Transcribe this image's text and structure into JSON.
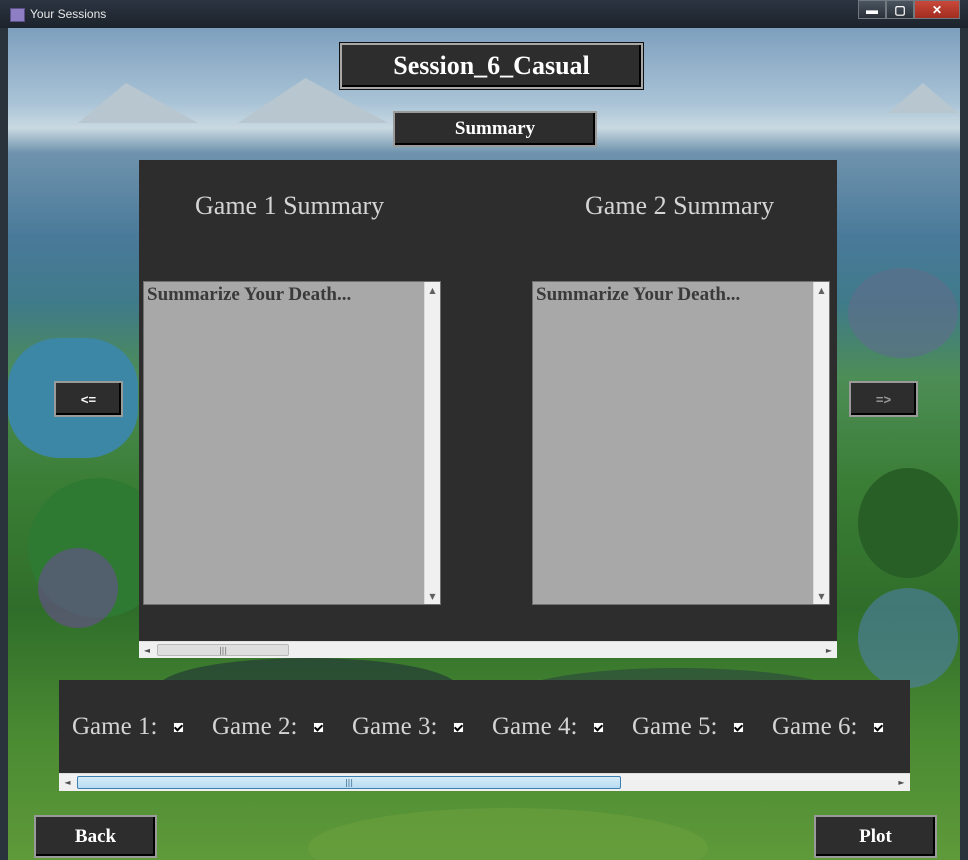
{
  "window": {
    "title": "Your Sessions",
    "controls": {
      "minimize": "▬",
      "maximize": "▢",
      "close": "✕"
    }
  },
  "session": {
    "title": "Session_6_Casual"
  },
  "summary_button": {
    "label": "Summary"
  },
  "summaries": [
    {
      "heading": "Game 1 Summary",
      "text": "Summarize Your Death..."
    },
    {
      "heading": "Game 2 Summary",
      "text": "Summarize Your Death..."
    }
  ],
  "nav": {
    "prev_label": "<=",
    "next_label": "=>",
    "next_enabled": false
  },
  "scroll": {
    "up": "▲",
    "down": "▼",
    "left": "◄",
    "right": "►",
    "grip": "|||"
  },
  "games": [
    {
      "label": "Game 1:",
      "checked": true
    },
    {
      "label": "Game 2:",
      "checked": true
    },
    {
      "label": "Game 3:",
      "checked": true
    },
    {
      "label": "Game 4:",
      "checked": true
    },
    {
      "label": "Game 5:",
      "checked": true
    },
    {
      "label": "Game 6:",
      "checked": true
    }
  ],
  "actions": {
    "back_label": "Back",
    "plot_label": "Plot"
  }
}
